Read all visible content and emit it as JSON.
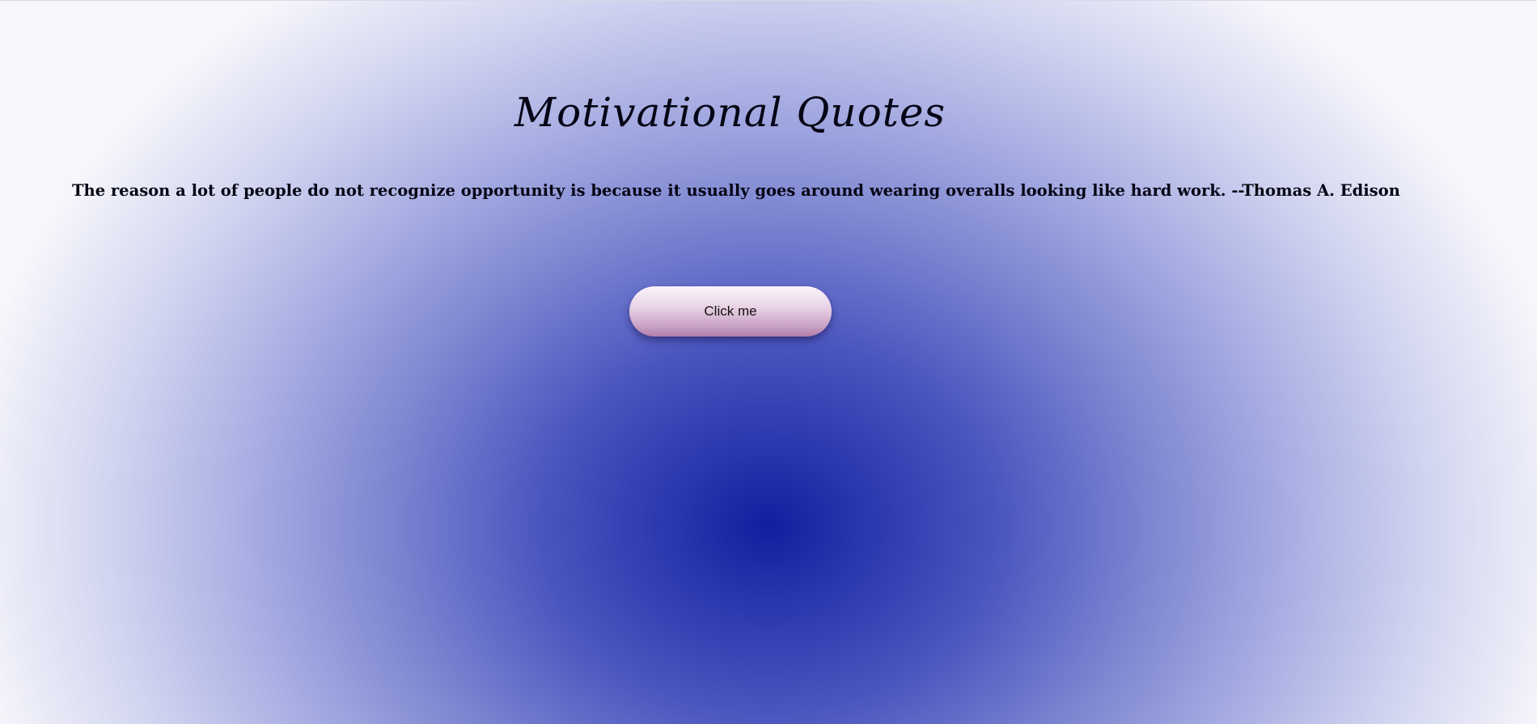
{
  "header": {
    "title": "Motivational Quotes"
  },
  "quote": {
    "text": "The reason a lot of people do not recognize opportunity is because it usually goes around wearing overalls looking like hard work. --Thomas A. Edison"
  },
  "actions": {
    "button_label": "Click me"
  },
  "colors": {
    "background_center": "#10209e",
    "background_edge": "#f6f6fb",
    "text": "#050515",
    "button_top": "#fbf4f9",
    "button_bottom": "#b27eab"
  }
}
